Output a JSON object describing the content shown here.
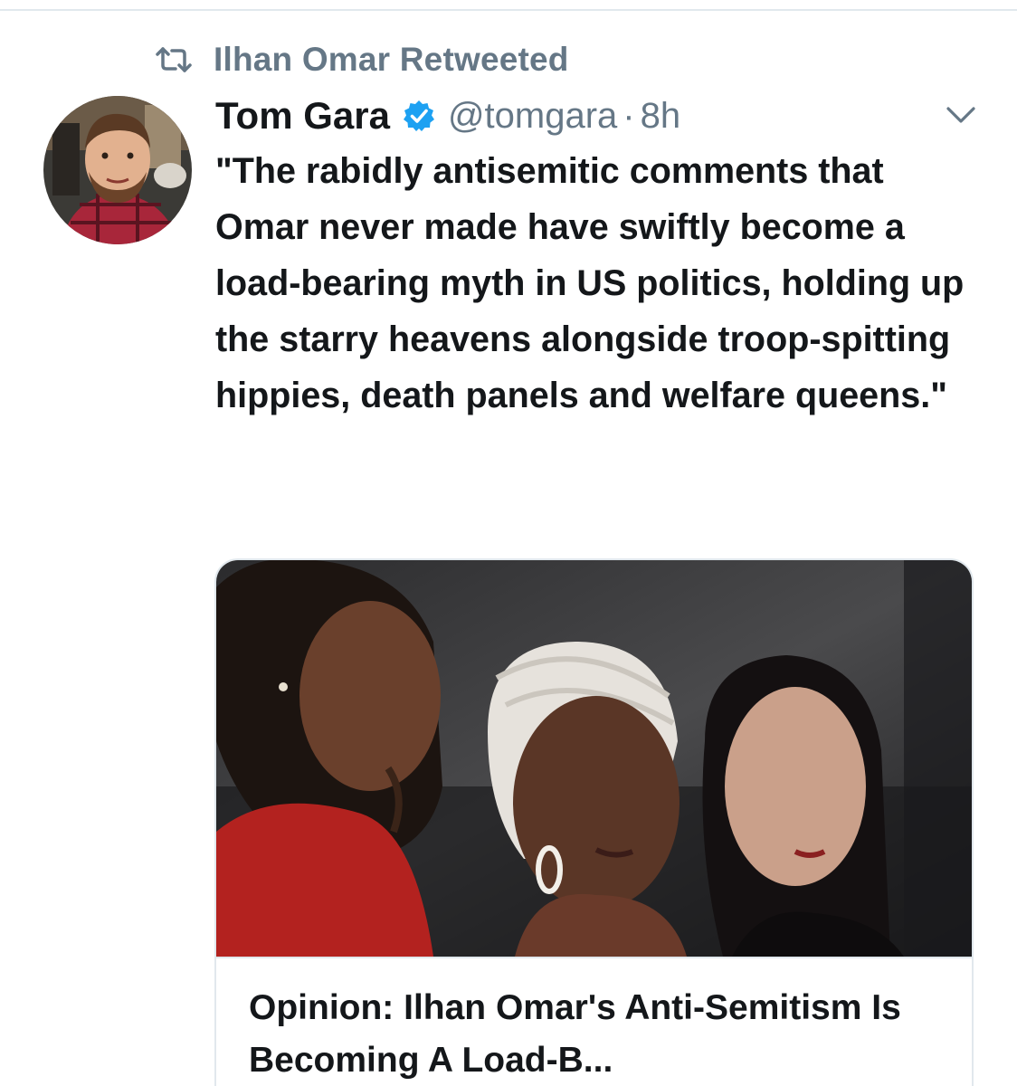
{
  "retweet": {
    "icon": "retweet-icon",
    "text": "Ilhan Omar Retweeted"
  },
  "tweet": {
    "author": {
      "display_name": "Tom Gara",
      "verified": true,
      "handle": "@tomgara",
      "avatar_icon": "avatar"
    },
    "separator": "·",
    "timestamp": "8h",
    "menu_icon": "chevron-down-icon",
    "text": "\"The rabidly antisemitic comments that Omar never made have swiftly become a load-bearing myth in US politics, holding up the starry heavens alongside troop-spitting hippies, death panels and welfare queens.\""
  },
  "card": {
    "title": "Opinion: Ilhan Omar's Anti-Semitism Is Becoming A Load-B..."
  },
  "colors": {
    "text_primary": "#14171a",
    "text_secondary": "#657786",
    "verified_blue": "#1da1f2",
    "divider": "#e1e8ed"
  }
}
